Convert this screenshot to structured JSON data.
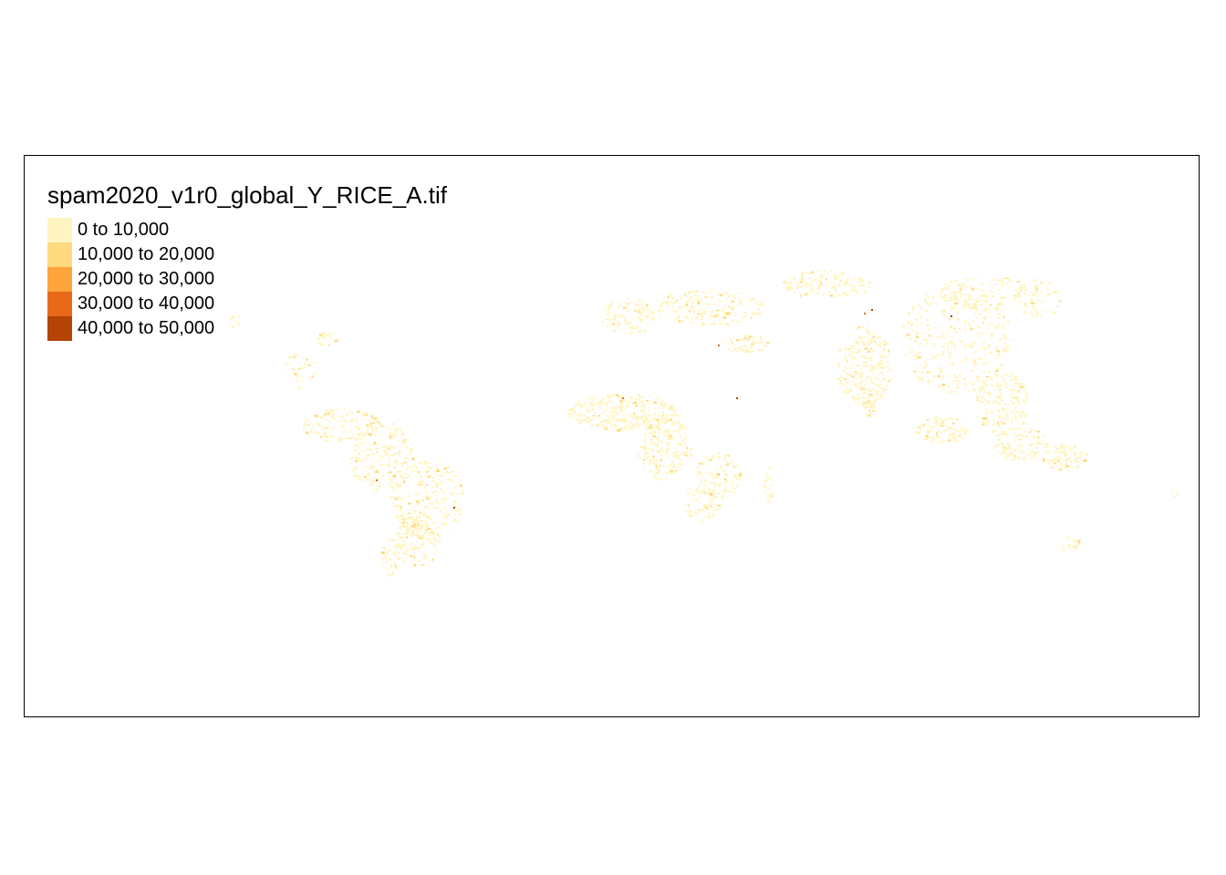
{
  "map": {
    "title": "spam2020_v1r0_global_Y_RICE_A.tif",
    "legend": [
      {
        "label": "0 to 10,000",
        "color": "#FFF5C2"
      },
      {
        "label": "10,000 to 20,000",
        "color": "#FED97F"
      },
      {
        "label": "20,000 to 30,000",
        "color": "#FDA43B"
      },
      {
        "label": "30,000 to 40,000",
        "color": "#E8691A"
      },
      {
        "label": "40,000 to 50,000",
        "color": "#B44306"
      }
    ]
  }
}
